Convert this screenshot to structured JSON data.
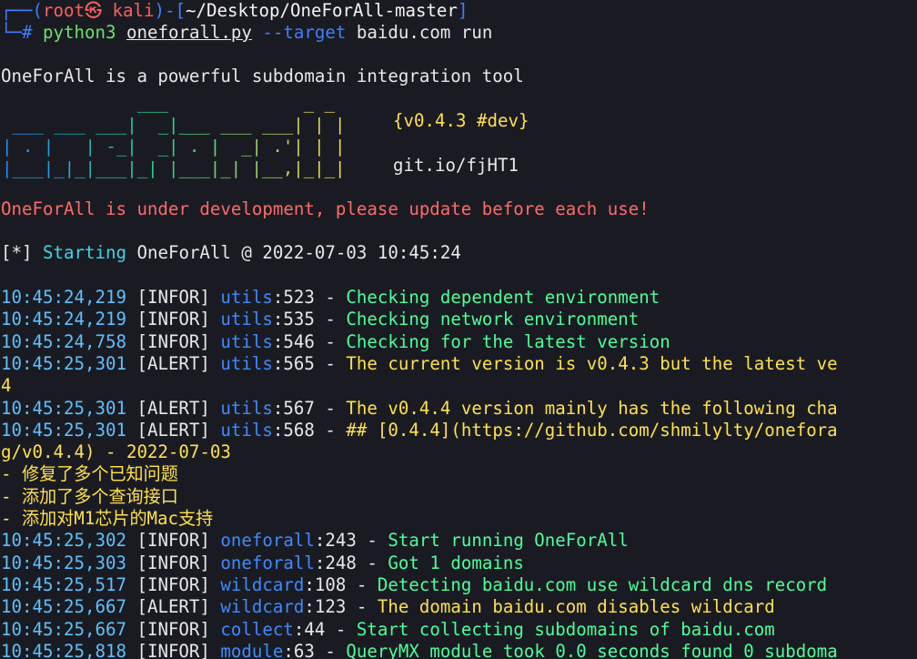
{
  "prompt": {
    "frame_top": "┌──(",
    "user": "root㉿ kali",
    "mid": ")-[",
    "path": "~/Desktop/OneForAll-master",
    "end": "]",
    "frame_bottom": "└─",
    "hash": "# ",
    "cmd_interp": "python3",
    "cmd_script": "oneforall.py",
    "cmd_flag": "--target",
    "cmd_rest": " baidu.com run"
  },
  "intro": "OneForAll is a powerful subdomain integration tool",
  "banner": {
    "art": [
      "             ___             _ _",
      " ___ ___ ___|  _|___ ___ ___| | |",
      "| . |   | -_|  _| . |  _| .'| | |",
      "|___|_|_|___|_| |___|_| |__,|_|_|"
    ],
    "version": "{v0.4.3 #dev}",
    "link": "git.io/fjHT1"
  },
  "warning": "OneForAll is under development, please update before each use!",
  "start": {
    "tag": "[*]",
    "label": "Starting",
    "text": " OneForAll @ 2022-07-03 10:45:24"
  },
  "logs": [
    {
      "time": "10:45:24,219",
      "level": "[INFOR]",
      "mod": "utils",
      "line": ":523",
      "sep": " - ",
      "msg": "Checking dependent environment",
      "type": "info"
    },
    {
      "time": "10:45:24,219",
      "level": "[INFOR]",
      "mod": "utils",
      "line": ":535",
      "sep": " - ",
      "msg": "Checking network environment",
      "type": "info"
    },
    {
      "time": "10:45:24,758",
      "level": "[INFOR]",
      "mod": "utils",
      "line": ":546",
      "sep": " - ",
      "msg": "Checking for the latest version",
      "type": "info"
    },
    {
      "time": "10:45:25,301",
      "level": "[ALERT]",
      "mod": "utils",
      "line": ":565",
      "sep": " - ",
      "msg": "The current version is v0.4.3 but the latest ve",
      "type": "alert"
    },
    {
      "cont": "4",
      "type": "alert"
    },
    {
      "time": "10:45:25,301",
      "level": "[ALERT]",
      "mod": "utils",
      "line": ":567",
      "sep": " - ",
      "msg": "The v0.4.4 version mainly has the following cha",
      "type": "alert"
    },
    {
      "time": "10:45:25,301",
      "level": "[ALERT]",
      "mod": "utils",
      "line": ":568",
      "sep": " - ",
      "msg": "## [0.4.4](https://github.com/shmilylty/onefora",
      "type": "alert"
    },
    {
      "cont": "g/v0.4.4) - 2022-07-03",
      "type": "alert"
    },
    {
      "cont": "- 修复了多个已知问题",
      "type": "alert"
    },
    {
      "cont": "- 添加了多个查询接口",
      "type": "alert"
    },
    {
      "cont": "- 添加对M1芯片的Mac支持",
      "type": "alert"
    },
    {
      "time": "10:45:25,302",
      "level": "[INFOR]",
      "mod": "oneforall",
      "line": ":243",
      "sep": " - ",
      "msg": "Start running OneForAll",
      "type": "info"
    },
    {
      "time": "10:45:25,303",
      "level": "[INFOR]",
      "mod": "oneforall",
      "line": ":248",
      "sep": " - ",
      "msg": "Got 1 domains",
      "type": "info"
    },
    {
      "time": "10:45:25,517",
      "level": "[INFOR]",
      "mod": "wildcard",
      "line": ":108",
      "sep": " - ",
      "msg": "Detecting baidu.com use wildcard dns record",
      "type": "info"
    },
    {
      "time": "10:45:25,667",
      "level": "[ALERT]",
      "mod": "wildcard",
      "line": ":123",
      "sep": " - ",
      "msg": "The domain baidu.com disables wildcard",
      "type": "alert"
    },
    {
      "time": "10:45:25,667",
      "level": "[INFOR]",
      "mod": "collect",
      "line": ":44",
      "sep": " - ",
      "msg": "Start collecting subdomains of baidu.com",
      "type": "info"
    },
    {
      "time": "10:45:25,818",
      "level": "[INFOR]",
      "mod": "module",
      "line": ":63",
      "sep": " - ",
      "msg": "QueryMX module took 0.0 seconds found 0 subdoma",
      "type": "info"
    }
  ],
  "colors": {
    "background": "#1a1b22",
    "prompt_frame": "#3f7fff",
    "prompt_user": "#ff5f5f",
    "command": "#6ee06e",
    "banner_art": "#28c8c8",
    "version": "#ffe14d",
    "warning": "#ff6a6a",
    "timestamp": "#5fc0ff",
    "module": "#3e8aff",
    "info_msg": "#4dff9a",
    "alert_msg": "#ffe14d"
  }
}
